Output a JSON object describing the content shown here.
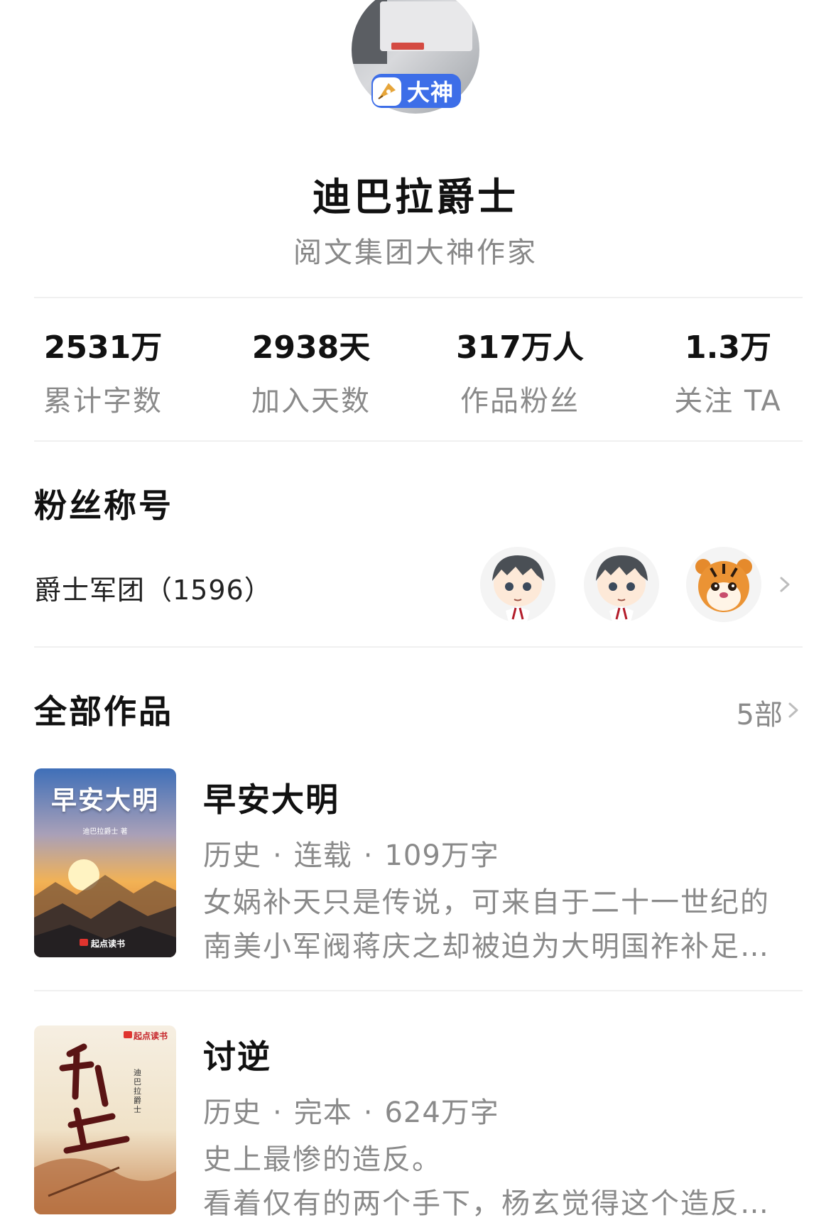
{
  "profile": {
    "badge": "大神",
    "name": "迪巴拉爵士",
    "subtitle": "阅文集团大神作家"
  },
  "stats": [
    {
      "value": "2531万",
      "label": "累计字数"
    },
    {
      "value": "2938天",
      "label": "加入天数"
    },
    {
      "value": "317万人",
      "label": "作品粉丝"
    },
    {
      "value": "1.3万",
      "label": "关注 TA"
    }
  ],
  "fans": {
    "title": "粉丝称号",
    "group_name": "爵士军团（1596）",
    "avatars": [
      "anime-boy-avatar",
      "anime-boy-avatar",
      "tiger-avatar"
    ]
  },
  "works": {
    "title": "全部作品",
    "count": "5部",
    "books": [
      {
        "title": "早安大明",
        "genre": "历史",
        "status": "连载",
        "words": "109万字",
        "desc_lines": [
          "女娲补天只是传说，可来自于二十一世纪的",
          "南美小军阀蒋庆之却被迫为大明国祚补足…"
        ],
        "cover_title": "早安大明",
        "cover_author": "迪巴拉爵士 著",
        "cover_publisher": "起点读书"
      },
      {
        "title": "讨逆",
        "genre": "历史",
        "status": "完本",
        "words": "624万字",
        "desc_lines": [
          "史上最惨的造反。",
          "看着仅有的两个手下，杨玄觉得这个造反…"
        ],
        "cover_title": "讨逆",
        "cover_author": "迪巴拉爵士",
        "cover_publisher": "起点读书"
      }
    ]
  },
  "colors": {
    "badge": "#3d6ee8",
    "text_primary": "#111111",
    "text_secondary": "#8a8a8a",
    "divider": "#f0f0f0"
  }
}
